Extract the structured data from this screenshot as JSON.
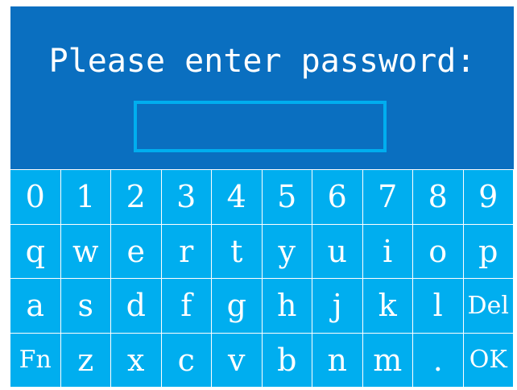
{
  "prompt": "Please enter password:",
  "password_value": "",
  "colors": {
    "panel": "#0a6fc0",
    "keys": "#00aeef",
    "text": "#ffffff"
  },
  "keys": [
    [
      "0",
      "1",
      "2",
      "3",
      "4",
      "5",
      "6",
      "7",
      "8",
      "9"
    ],
    [
      "q",
      "w",
      "e",
      "r",
      "t",
      "y",
      "u",
      "i",
      "o",
      "p"
    ],
    [
      "a",
      "s",
      "d",
      "f",
      "g",
      "h",
      "j",
      "k",
      "l",
      "Del"
    ],
    [
      "Fn",
      "z",
      "x",
      "c",
      "v",
      "b",
      "n",
      "m",
      ".",
      "OK"
    ]
  ]
}
